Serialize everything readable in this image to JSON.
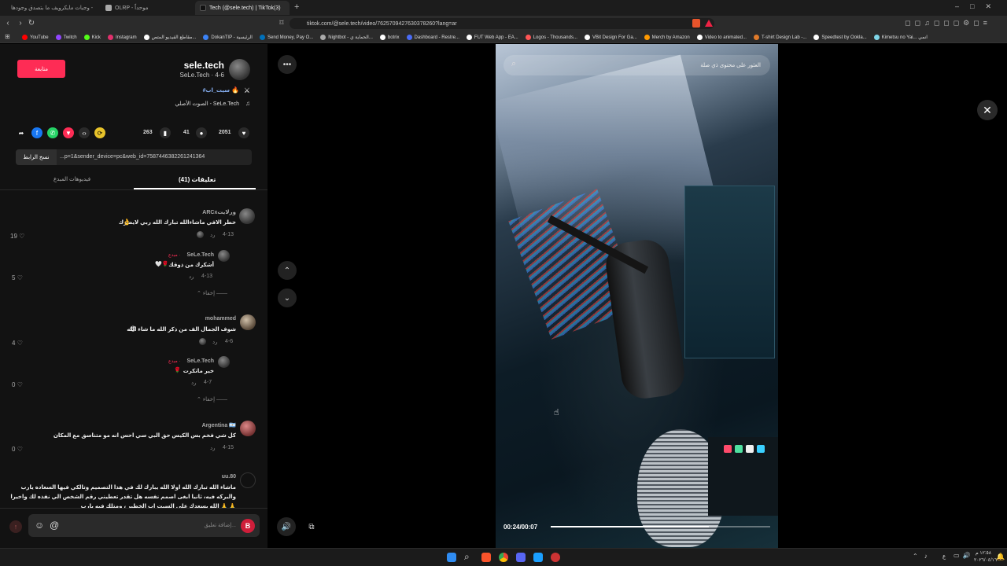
{
  "browser": {
    "tabs": [
      {
        "label": "وجبات مايكرويف ما بتصدق وجودها -"
      },
      {
        "label": "OLRP - موحداً"
      },
      {
        "label": "Tech (@sele.tech) | TikTok(3)"
      }
    ],
    "new_tab": "+",
    "url": "tiktok.com/@sele.tech/video/7625709427630378260?lang=ar",
    "bookmarks": [
      {
        "label": "YouTube",
        "color": "#ff0000"
      },
      {
        "label": "Twitch",
        "color": "#9146ff"
      },
      {
        "label": "Kick",
        "color": "#53fc18"
      },
      {
        "label": "Instagram",
        "color": "#e1306c"
      },
      {
        "label": "مقاطع الفيديو المتص...",
        "color": "#ffffff"
      },
      {
        "label": "DokanTIP - الرئيسية",
        "color": "#3b82f6"
      },
      {
        "label": "Send Money, Pay O...",
        "color": "#0070ba"
      },
      {
        "label": "Nightbot - الحماية ي...",
        "color": "#aaaaaa"
      },
      {
        "label": "botrix",
        "color": "#ffffff"
      },
      {
        "label": "Dashboard - Restre...",
        "color": "#4a6cf7"
      },
      {
        "label": "FUT Web App - EA...",
        "color": "#ffffff"
      },
      {
        "label": "Logos - Thousands...",
        "color": "#ff5555"
      },
      {
        "label": "VBit Design For Ga...",
        "color": "#ffffff"
      },
      {
        "label": "Merch by Amazon",
        "color": "#ff9900"
      },
      {
        "label": "Video to animated...",
        "color": "#ffffff"
      },
      {
        "label": "T-shirt Design Lab -...",
        "color": "#e07a2a"
      },
      {
        "label": "Speedtest by Ookla...",
        "color": "#ffffff"
      },
      {
        "label": "Kimetsu no Yai... انمي",
        "color": "#7fd6e8"
      }
    ]
  },
  "creator": {
    "name": "sele.tech",
    "subtitle": "SeLe.Tech · 4-6",
    "follow_label": "متابعة",
    "caption": "#سيت_اب",
    "sound": "الصوت الأصلي - SeLe.Tech"
  },
  "stats": {
    "likes": "2051",
    "comments": "41",
    "saves": "263"
  },
  "link": {
    "copy_label": "نسخ الرابط",
    "value": "...p=1&sender_device=pc&web_id=7587446382261241364"
  },
  "tabs": {
    "comments": "تعليقات (41)",
    "creator_videos": "فيديوهات المبدع"
  },
  "comments": [
    {
      "user": "ARCxورلايت",
      "text": "خطر الافي ماشاءالله تبارك الله ربي لايضرك",
      "emoji": "👌",
      "date": "4-13",
      "reply": "رد",
      "likes": "19"
    },
    {
      "user": "SeLe.Tech",
      "tag": "مبدع ·",
      "text": "أشكرك من ذوقك",
      "emoji": "🤍🌹",
      "date": "4-13",
      "reply": "رد",
      "likes": "5",
      "hide": "إخفاء"
    },
    {
      "user": "mohammed",
      "text": "شوف الجمال الف من ذكر الله ما شاء الله",
      "emoji": "😍",
      "date": "4-6",
      "reply": "رد",
      "likes": "4"
    },
    {
      "user": "SeLe.Tech",
      "tag": "مبدع ·",
      "text": "خير ماتكرت",
      "emoji": "🌹",
      "date": "4-7",
      "reply": "رد",
      "likes": "0",
      "hide": "إخفاء"
    },
    {
      "user": "Argentina 🇦🇷",
      "text": "كل شي فخم بس الكيس حق البي سي احس انه مو متناسق مع المكان",
      "date": "4-15",
      "reply": "رد",
      "likes": "0"
    },
    {
      "user": "uu.80",
      "text": "ماشاء الله تبارك الله اولا الله يبارك لك في هذا التصميم وتالكي فيها السعاده يارب",
      "text2": "والبركه فيه، ثانيا ابغى اصمم نفسه هل تقدر تعطيني رقم الشخص الي نفذه لك واخيرا",
      "text3": "الله يسعدك على السيت اب الخطير ، ومتلك فيه يارب 🙏 🙏"
    }
  ],
  "comment_input": {
    "placeholder": "إضافة تعليق..."
  },
  "video": {
    "search_placeholder": "العثور على محتوى ذي صلة",
    "time": "00:24/00:07",
    "progress_fraction": 0.72
  },
  "taskbar": {
    "lang": "ع",
    "time": "١٢:٥٨ م",
    "date": "٢٠٢٦/٠٤/١٦"
  }
}
